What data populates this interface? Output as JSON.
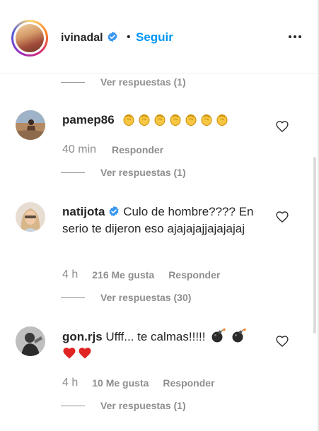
{
  "post": {
    "username": "ivinadal",
    "separator": "•",
    "follow_label": "Seguir"
  },
  "replies_top": {
    "label": "Ver respuestas (1)"
  },
  "comments": [
    {
      "username": "pamep86",
      "text": "",
      "emoji": "clapping-hands x7",
      "time": "40 min",
      "likes": "",
      "respond_label": "Responder",
      "replies_label": "Ver respuestas (1)"
    },
    {
      "username": "natijota",
      "text": "Culo de hombre???? En serio te dijeron eso ajajajajjajajajaj",
      "time": "4 h",
      "likes": "216 Me gusta",
      "respond_label": "Responder",
      "replies_label": "Ver respuestas (30)"
    },
    {
      "username": "gon.rjs",
      "text": "Ufff... te calmas!!!!!",
      "emoji": "bomb x2, red-heart x2",
      "time": "4 h",
      "likes": "10 Me gusta",
      "respond_label": "Responder",
      "replies_label": "Ver respuestas (1)"
    }
  ],
  "colors": {
    "link_blue": "#0095f6",
    "muted_gray": "#8e8e8e",
    "verified_blue": "#3897f0",
    "text_dark": "#262626"
  }
}
